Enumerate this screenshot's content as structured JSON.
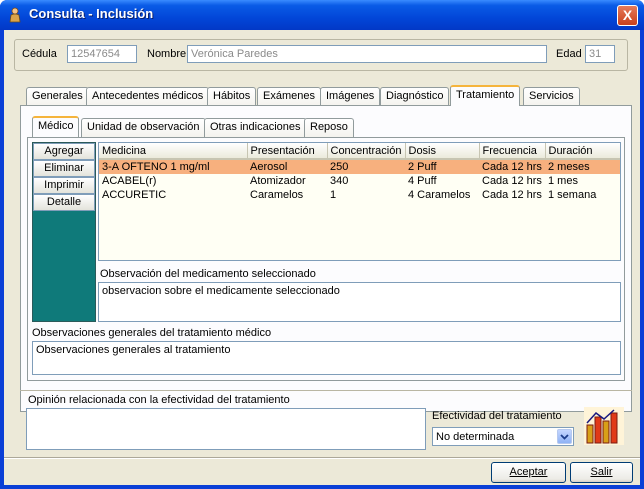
{
  "window": {
    "title": "Consulta - Inclusión",
    "close_label": "X"
  },
  "patient": {
    "cedula_label": "Cédula",
    "cedula_value": "12547654",
    "nombre_label": "Nombre",
    "nombre_value": "Verónica Paredes",
    "edad_label": "Edad",
    "edad_value": "31"
  },
  "main_tabs": [
    {
      "label": "Generales"
    },
    {
      "label": "Antecedentes médicos"
    },
    {
      "label": "Hábitos"
    },
    {
      "label": "Exámenes"
    },
    {
      "label": "Imágenes"
    },
    {
      "label": "Diagnóstico"
    },
    {
      "label": "Tratamiento"
    },
    {
      "label": "Servicios"
    }
  ],
  "sub_tabs": [
    {
      "label": "Médico"
    },
    {
      "label": "Unidad de observación"
    },
    {
      "label": "Otras indicaciones"
    },
    {
      "label": "Reposo"
    }
  ],
  "side_buttons": [
    {
      "label": "Agregar"
    },
    {
      "label": "Eliminar"
    },
    {
      "label": "Imprimir"
    },
    {
      "label": "Detalle"
    }
  ],
  "medications": {
    "columns": [
      "Medicina",
      "Presentación",
      "Concentración",
      "Dosis",
      "Frecuencia",
      "Duración"
    ],
    "rows": [
      [
        "3-A OFTENO 1 mg/ml",
        "Aerosol",
        "250",
        "2 Puff",
        "Cada 12 hrs",
        "2 meses"
      ],
      [
        "ACABEL(r)",
        "Atomizador",
        "340",
        "4 Puff",
        "Cada 12 hrs",
        "1 mes"
      ],
      [
        "ACCURETIC",
        "Caramelos",
        "1",
        "4 Caramelos",
        "Cada 12 hrs",
        "1 semana"
      ]
    ],
    "selected_row": 0,
    "selected_color": "#f7b07e"
  },
  "obs_medicamento": {
    "label": "Observación del medicamento seleccionado",
    "value": "observacion sobre el medicamente seleccionado"
  },
  "obs_generales": {
    "label": "Observaciones generales del tratamiento médico",
    "value": "Observaciones generales al tratamiento"
  },
  "opinion": {
    "label": "Opinión relacionada con la efectividad del tratamiento",
    "value": ""
  },
  "efectividad": {
    "label": "Efectividad del tratamiento",
    "selected": "No determinada",
    "icon": "bar-chart-icon"
  },
  "footer": {
    "aceptar_label": "Aceptar",
    "salir_label": "Salir"
  },
  "colors": {
    "titlebar": "#0246d8",
    "side_panel": "#0f7a7a",
    "active_tab_accent": "#f5b43c"
  }
}
